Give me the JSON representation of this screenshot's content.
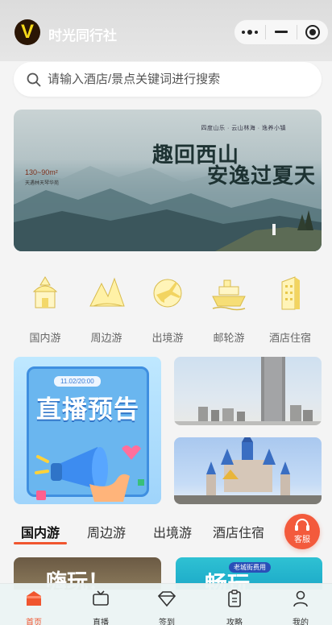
{
  "header": {
    "logo_letter": "V",
    "app_title": "时光同行社",
    "capsule": {
      "more_icon": "more-dots-icon",
      "minimize_icon": "minimize-icon",
      "close_icon": "target-close-icon"
    }
  },
  "search": {
    "placeholder": "请输入酒店/景点关键词进行搜索",
    "icon": "search-icon"
  },
  "banner": {
    "tag": "四度山乐 · 云山林海 · 逸养小镇",
    "headline_line1": "趣回西山",
    "headline_line2": "安逸过夏天",
    "area": "130~90m²",
    "area_sub": "天遇林天琴华苑"
  },
  "categories": [
    {
      "label": "国内游",
      "icon": "temple-icon"
    },
    {
      "label": "周边游",
      "icon": "mountain-icon"
    },
    {
      "label": "出境游",
      "icon": "plane-globe-icon"
    },
    {
      "label": "邮轮游",
      "icon": "cruise-ship-icon"
    },
    {
      "label": "酒店住宿",
      "icon": "hotel-building-icon"
    }
  ],
  "promo": {
    "live_time": "11.02/20:00",
    "live_title": "直播预告"
  },
  "tabs": [
    {
      "label": "国内游",
      "active": true
    },
    {
      "label": "周边游",
      "active": false
    },
    {
      "label": "出境游",
      "active": false
    },
    {
      "label": "酒店住宿",
      "active": false
    }
  ],
  "service": {
    "label": "客服",
    "icon": "headset-icon"
  },
  "cards_bottom": {
    "left_title": "嗨玩！",
    "right_pill": "老城街费用",
    "right_title": "畅玩"
  },
  "bottom_nav": [
    {
      "label": "首页",
      "icon": "home-icon",
      "active": true
    },
    {
      "label": "直播",
      "icon": "tv-icon",
      "active": false
    },
    {
      "label": "签到",
      "icon": "diamond-icon",
      "active": false
    },
    {
      "label": "攻略",
      "icon": "clipboard-icon",
      "active": false
    },
    {
      "label": "我的",
      "icon": "person-icon",
      "active": false
    }
  ],
  "colors": {
    "accent": "#f0552f",
    "logo_bg": "#2b1605",
    "logo_fg": "#f6d91a"
  }
}
